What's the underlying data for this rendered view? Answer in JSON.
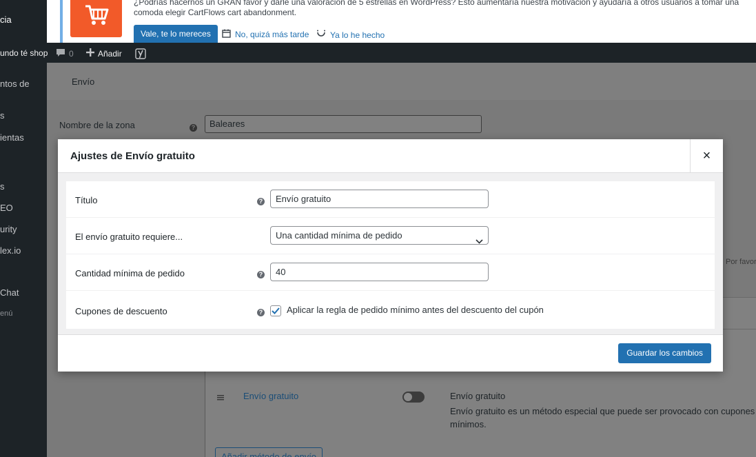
{
  "sidebar": {
    "items": [
      {
        "label": "cia"
      },
      {
        "label": "ntos de"
      },
      {
        "label": "s"
      },
      {
        "label": "ientas"
      },
      {
        "label": "s"
      },
      {
        "label": "EO"
      },
      {
        "label": "urity"
      },
      {
        "label": "lex.io"
      },
      {
        "label": "Chat"
      },
      {
        "label": "enú"
      }
    ]
  },
  "notice": {
    "text": "¿Podrías hacernos un GRAN favor y darle una valoración de 5 estrellas en WordPress? Esto aumentaría nuestra motivación y ayudaría a otros usuarios a tomar una comoda elegir CartFlows cart abandonment.",
    "primary_button": "Vale, te lo mereces",
    "later_link": "No, quizá más tarde",
    "done_link": "Ya lo he hecho",
    "logo_icon": "cart-icon"
  },
  "adminbar": {
    "site_name": "undo té shop",
    "comments_count": "0",
    "add_label": "Añadir",
    "yoast_icon": "yoast-icon"
  },
  "background_page": {
    "tab_label": "Envío",
    "zone_name_label": "Nombre de la zona",
    "zone_name_value": "Baleares",
    "hint_text": "Por favor",
    "method_link": "Envío gratuito",
    "method_title": "Envío gratuito",
    "method_description": "Envío gratuito es un método especial que puede ser provocado con cupones y mínimos.",
    "add_method_button": "Añadir método de envío"
  },
  "modal": {
    "title": "Ajustes de Envío gratuito",
    "close_symbol": "×",
    "fields": {
      "title_label": "Título",
      "title_value": "Envío gratuito",
      "requires_label": "El envío gratuito requiere...",
      "requires_value": "Una cantidad mínima de pedido",
      "min_amount_label": "Cantidad mínima de pedido",
      "min_amount_value": "40",
      "coupons_label": "Cupones de descuento",
      "coupons_checkbox_label": "Aplicar la regla de pedido mínimo antes del descuento del cupón",
      "coupons_checked": true
    },
    "save_button": "Guardar los cambios",
    "help_symbol": "?"
  },
  "colors": {
    "primary": "#2271b1",
    "admin_dark": "#1d2327",
    "notice_accent": "#72aee6",
    "brand_orange": "#f25a29"
  }
}
